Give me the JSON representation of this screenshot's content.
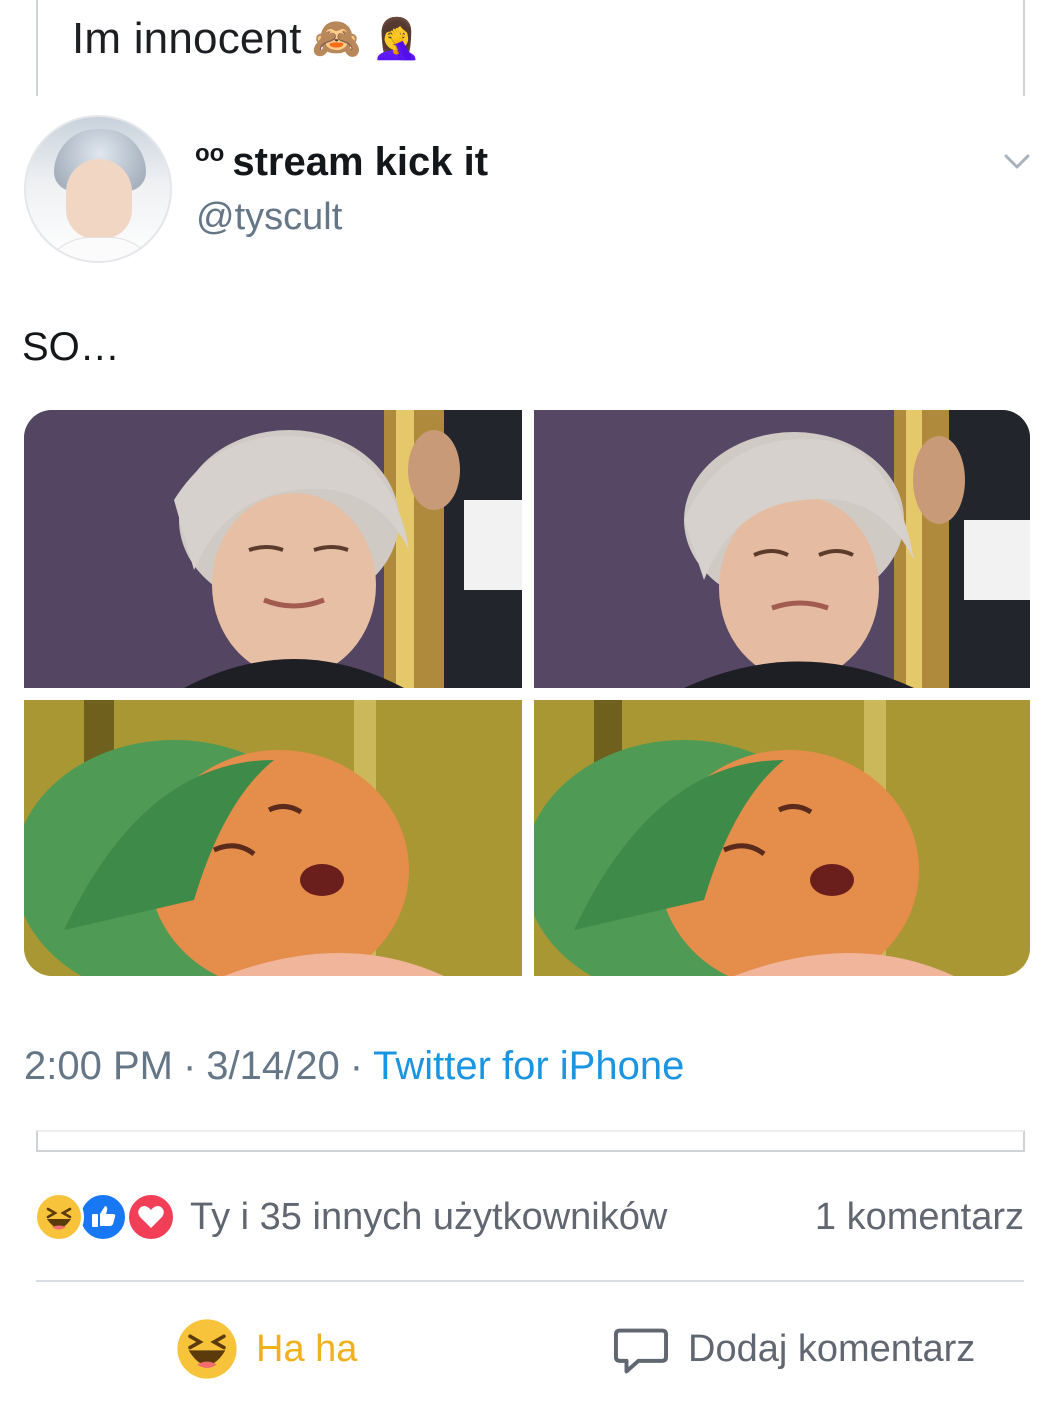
{
  "caption": {
    "text": "Im innocent",
    "emoji_1": "🙈",
    "emoji_2": "🤦‍♀️"
  },
  "tweet": {
    "display_name": "stream kick it",
    "name_prefix": "oo",
    "handle": "@tyscult",
    "text": "SO…",
    "time": "2:00 PM",
    "date": "3/14/20",
    "separator": "·",
    "source": "Twitter for iPhone",
    "icons": {
      "avatar": "profile-photo",
      "menu": "chevron-down-icon"
    }
  },
  "reactions": {
    "summary": "Ty i 35 innych użytkowników",
    "comments": "1 komentarz",
    "types": [
      "haha",
      "like",
      "love"
    ]
  },
  "actions": {
    "haha_label": "Ha ha",
    "comment_label": "Dodaj komentarz"
  },
  "colors": {
    "link_blue": "#1b95e0",
    "haha_yellow": "#f0b21c",
    "like_blue": "#1877f2",
    "love_red": "#f33e58",
    "muted_text": "#606770",
    "handle_gray": "#657786"
  }
}
